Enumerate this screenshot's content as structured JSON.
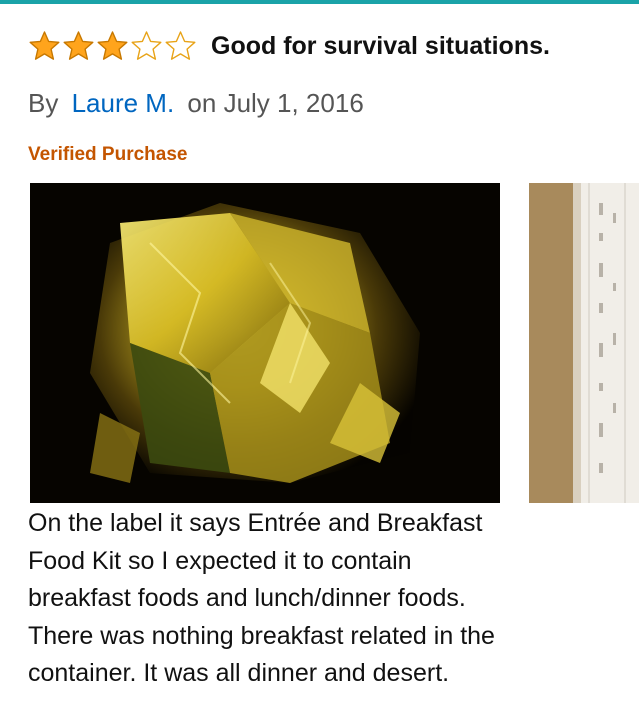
{
  "review": {
    "rating": 3,
    "max_rating": 5,
    "title": "Good for survival situations.",
    "by_label": "By",
    "author": "Laure M.",
    "date_text": "on July 1, 2016",
    "verified_label": "Verified Purchase",
    "body_lines": [
      "On the label it says Entrée and Breakfast",
      "Food Kit so I expected it to contain",
      "breakfast foods and lunch/dinner foods.",
      "There was nothing breakfast related in the",
      "container. It was all dinner and desert."
    ]
  },
  "colors": {
    "accent_rule": "#1aa3a8",
    "star_fill": "#ffa41c",
    "author_link": "#0066c0",
    "verified": "#c45500"
  },
  "icons": [
    "star-filled-icon",
    "star-empty-icon"
  ]
}
